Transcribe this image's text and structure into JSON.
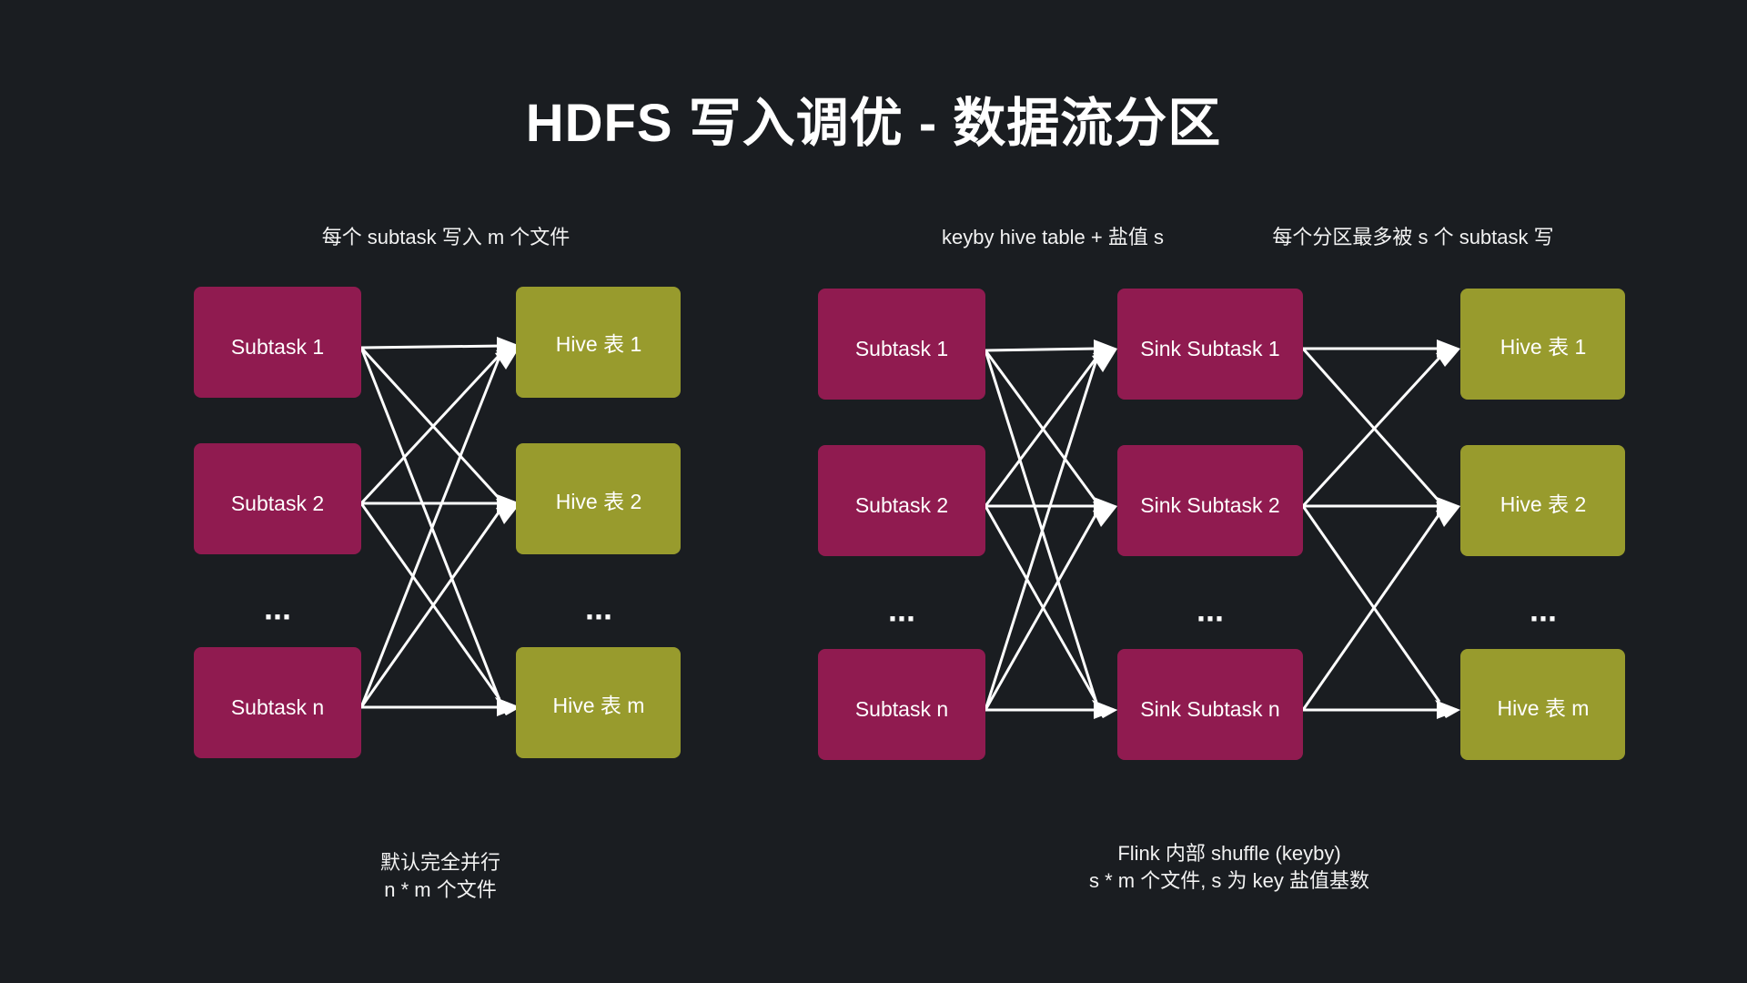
{
  "title": "HDFS 写入调优 - 数据流分区",
  "colors": {
    "background": "#1a1d21",
    "subtask_box": "#901b50",
    "hive_box": "#989b2d",
    "edge": "#ffffff",
    "text": "#ffffff"
  },
  "left_panel": {
    "top_label": "每个 subtask 写入 m 个文件",
    "source_nodes": [
      {
        "label": "Subtask 1"
      },
      {
        "label": "Subtask 2"
      },
      {
        "label": "Subtask n"
      }
    ],
    "target_nodes": [
      {
        "label": "Hive 表 1"
      },
      {
        "label": "Hive 表 2"
      },
      {
        "label": "Hive 表 m"
      }
    ],
    "source_ellipsis": "...",
    "target_ellipsis": "...",
    "caption_line1": "默认完全并行",
    "caption_line2": "n * m 个文件"
  },
  "right_panel": {
    "top_label_1": "keyby hive table + 盐值 s",
    "top_label_2": "每个分区最多被 s 个 subtask 写",
    "source_nodes": [
      {
        "label": "Subtask 1"
      },
      {
        "label": "Subtask 2"
      },
      {
        "label": "Subtask n"
      }
    ],
    "sink_nodes": [
      {
        "label": "Sink Subtask 1"
      },
      {
        "label": "Sink Subtask 2"
      },
      {
        "label": "Sink Subtask n"
      }
    ],
    "target_nodes": [
      {
        "label": "Hive 表 1"
      },
      {
        "label": "Hive 表 2"
      },
      {
        "label": "Hive 表 m"
      }
    ],
    "source_ellipsis": "...",
    "sink_ellipsis": "...",
    "target_ellipsis": "...",
    "caption_line1": "Flink 内部 shuffle (keyby)",
    "caption_line2": "s * m 个文件,  s 为 key 盐值基数"
  }
}
